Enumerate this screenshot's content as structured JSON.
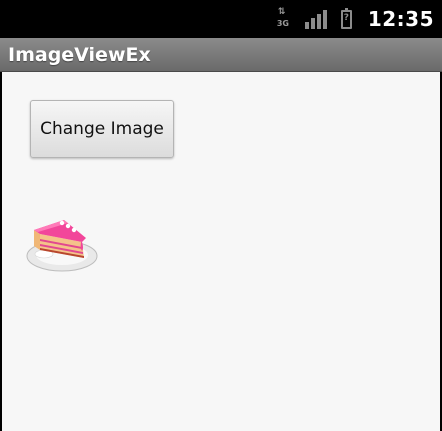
{
  "status_bar": {
    "network_label": "3G",
    "network_icon": "network-3g-icon",
    "signal_icon": "signal-bars-icon",
    "battery_icon": "battery-unknown-icon",
    "battery_symbol": "?",
    "time": "12:35"
  },
  "title_bar": {
    "title": "ImageViewEx"
  },
  "main": {
    "button_label": "Change Image",
    "image_icon": "cake-slice-image"
  },
  "colors": {
    "status_bar_bg": "#000000",
    "title_bar_bg": "#7a7a7a",
    "content_bg": "#f7f7f7"
  }
}
